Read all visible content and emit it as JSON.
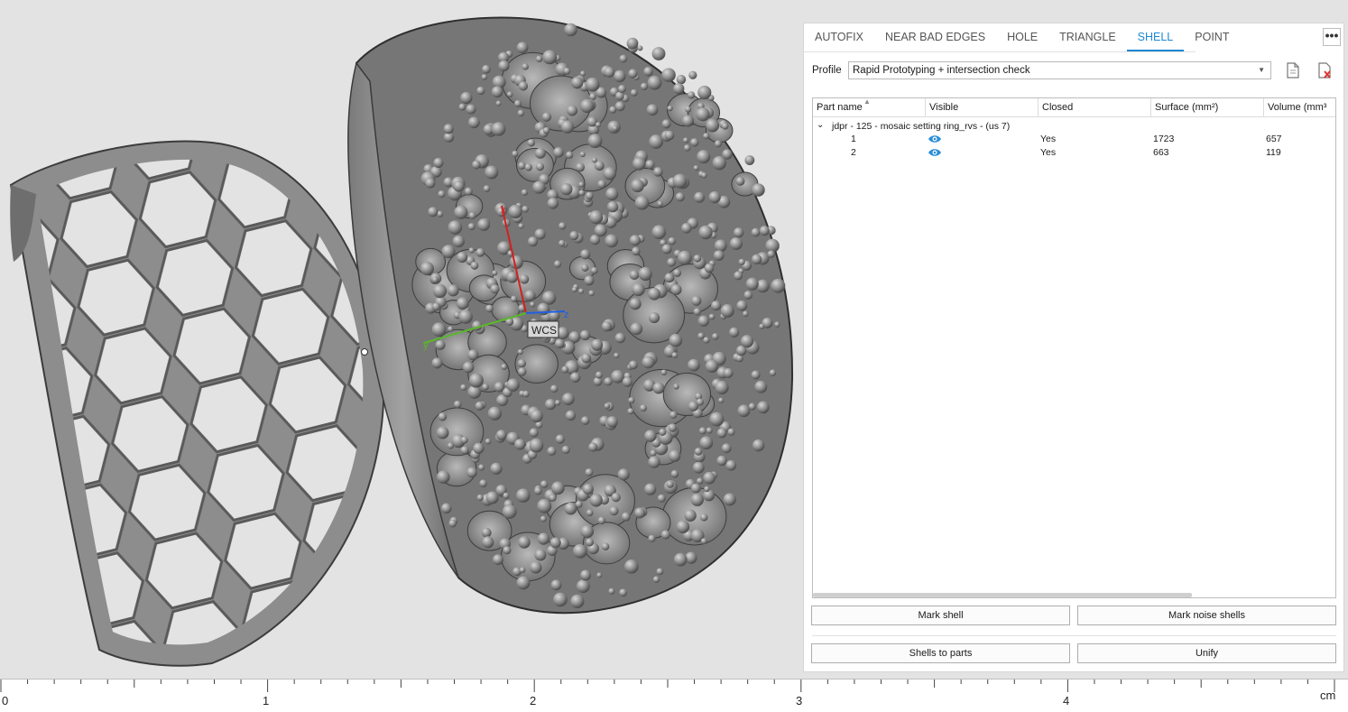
{
  "tabs": [
    "AUTOFIX",
    "NEAR BAD EDGES",
    "HOLE",
    "TRIANGLE",
    "SHELL",
    "POINT"
  ],
  "active_tab": "SHELL",
  "more_label": "•••",
  "profile": {
    "label": "Profile",
    "value": "Rapid Prototyping + intersection check"
  },
  "table": {
    "columns": [
      "Part name",
      "Visible",
      "Closed",
      "Surface (mm²)",
      "Volume (mm³"
    ],
    "group": "jdpr - 125 - mosaic setting ring_rvs - (us 7)",
    "rows": [
      {
        "name": "1",
        "closed": "Yes",
        "surface": "1723",
        "volume": "657"
      },
      {
        "name": "2",
        "closed": "Yes",
        "surface": "663",
        "volume": "119"
      }
    ]
  },
  "buttons": {
    "mark_shell": "Mark shell",
    "mark_noise": "Mark noise shells",
    "shells_to_parts": "Shells to parts",
    "unify": "Unify"
  },
  "viewport": {
    "wcs_label": "WCS",
    "axis_x": "x",
    "axis_y": "y",
    "axis_z": "z"
  },
  "ruler": {
    "labels": [
      "0",
      "1",
      "2",
      "3",
      "4"
    ],
    "unit": "cm"
  },
  "colors": {
    "accent": "#1e88d4",
    "axis_x": "#d42020",
    "axis_y": "#5ab82a",
    "axis_z": "#2060e0"
  }
}
